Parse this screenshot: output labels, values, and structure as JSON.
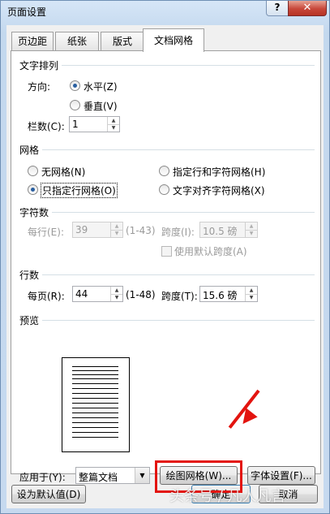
{
  "window": {
    "title": "页面设置",
    "help_label": "?",
    "close_label": "✕"
  },
  "tabs": [
    {
      "label": "页边距"
    },
    {
      "label": "纸张"
    },
    {
      "label": "版式"
    },
    {
      "label": "文档网格"
    }
  ],
  "text_direction": {
    "section": "文字排列",
    "direction_label": "方向:",
    "horizontal": "水平(Z)",
    "vertical": "垂直(V)",
    "columns_label": "栏数(C):",
    "columns_value": "1",
    "selected": "水平(Z)"
  },
  "grid": {
    "section": "网格",
    "options": [
      "无网格(N)",
      "指定行和字符网格(H)",
      "只指定行网格(O)",
      "文字对齐字符网格(X)"
    ],
    "selected": "只指定行网格(O)"
  },
  "characters": {
    "section": "字符数",
    "per_line_label": "每行(E):",
    "per_line_value": "39",
    "per_line_range": "(1-43)",
    "pitch_label": "跨度(I):",
    "pitch_value": "10.5 磅",
    "default_pitch_label": "使用默认跨度(A)"
  },
  "lines": {
    "section": "行数",
    "per_page_label": "每页(R):",
    "per_page_value": "44",
    "per_page_range": "(1-48)",
    "pitch_label": "跨度(T):",
    "pitch_value": "15.6 磅"
  },
  "preview": {
    "section": "预览"
  },
  "apply": {
    "label": "应用于(Y):",
    "value": "整篇文档"
  },
  "buttons": {
    "draw_grid": "绘图网格(W)...",
    "font_settings": "字体设置(F)...",
    "set_default": "设为默认值(D)",
    "ok": "确定",
    "cancel": "取消"
  },
  "watermark": "头条号 / 凡人凡言",
  "colors": {
    "highlight": "#e3140f",
    "title_bar": "#c9dcf1"
  }
}
